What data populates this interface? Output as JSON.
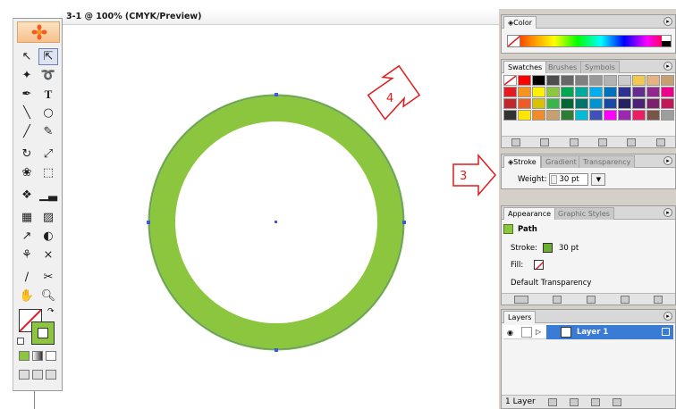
{
  "document": {
    "title": "3-1 @ 100% (CMYK/Preview)"
  },
  "callouts": {
    "a": "4",
    "b": "3"
  },
  "colors": {
    "stroke_green": "#8cc63f",
    "selection_blue": "#3b5bdb",
    "callout_red": "#e01b1b",
    "layer_highlight": "#3a7bd5"
  },
  "tools": [
    "selection-tool",
    "direct-selection-tool",
    "magic-wand-tool",
    "lasso-tool",
    "pen-tool",
    "type-tool",
    "line-tool",
    "ellipse-tool",
    "paintbrush-tool",
    "pencil-tool",
    "rotate-tool",
    "scale-tool",
    "warp-tool",
    "free-transform-tool",
    "symbol-sprayer-tool",
    "graph-tool",
    "mesh-tool",
    "gradient-tool",
    "eyedropper-tool",
    "blend-tool",
    "live-paint-tool",
    "live-paint-selection-tool",
    "slice-tool",
    "scissors-tool",
    "hand-tool",
    "zoom-tool"
  ],
  "color_panel": {
    "tab": "Color"
  },
  "swatches_panel": {
    "tabs": [
      "Swatches",
      "Brushes",
      "Symbols"
    ],
    "colors": [
      "#ffffff",
      "#ff0000",
      "#000000",
      "#4d4d4d",
      "#666666",
      "#808080",
      "#999999",
      "#b3b3b3",
      "#cccccc",
      "#f2c94c",
      "#e6b380",
      "#c8a070",
      "#e31b23",
      "#f7941d",
      "#fff200",
      "#8dc63f",
      "#00a651",
      "#00a99d",
      "#00aeef",
      "#0072bc",
      "#2e3192",
      "#662d91",
      "#92278f",
      "#ec008c",
      "#c1272d",
      "#f15a24",
      "#d9c200",
      "#39b54a",
      "#006837",
      "#00746b",
      "#0095d0",
      "#1b4aa5",
      "#262262",
      "#4b2277",
      "#7c1f6e",
      "#c2185b",
      "#333333",
      "#ffe400",
      "#f28c28",
      "#c8a070",
      "#2e7d32",
      "#00bcd4",
      "#3f51b5",
      "#ff00ff",
      "#9c27b0",
      "#e91e63",
      "#795548",
      "#9e9e9e"
    ]
  },
  "stroke_panel": {
    "tabs": [
      "Stroke",
      "Gradient",
      "Transparency"
    ],
    "weight_label": "Weight:",
    "weight_value": "30 pt"
  },
  "appearance_panel": {
    "tabs": [
      "Appearance",
      "Graphic Styles"
    ],
    "object": "Path",
    "stroke_label": "Stroke:",
    "stroke_value": "30 pt",
    "fill_label": "Fill:",
    "transparency": "Default Transparency"
  },
  "layers_panel": {
    "tab": "Layers",
    "layer_name": "Layer 1",
    "count": "1 Layer"
  }
}
